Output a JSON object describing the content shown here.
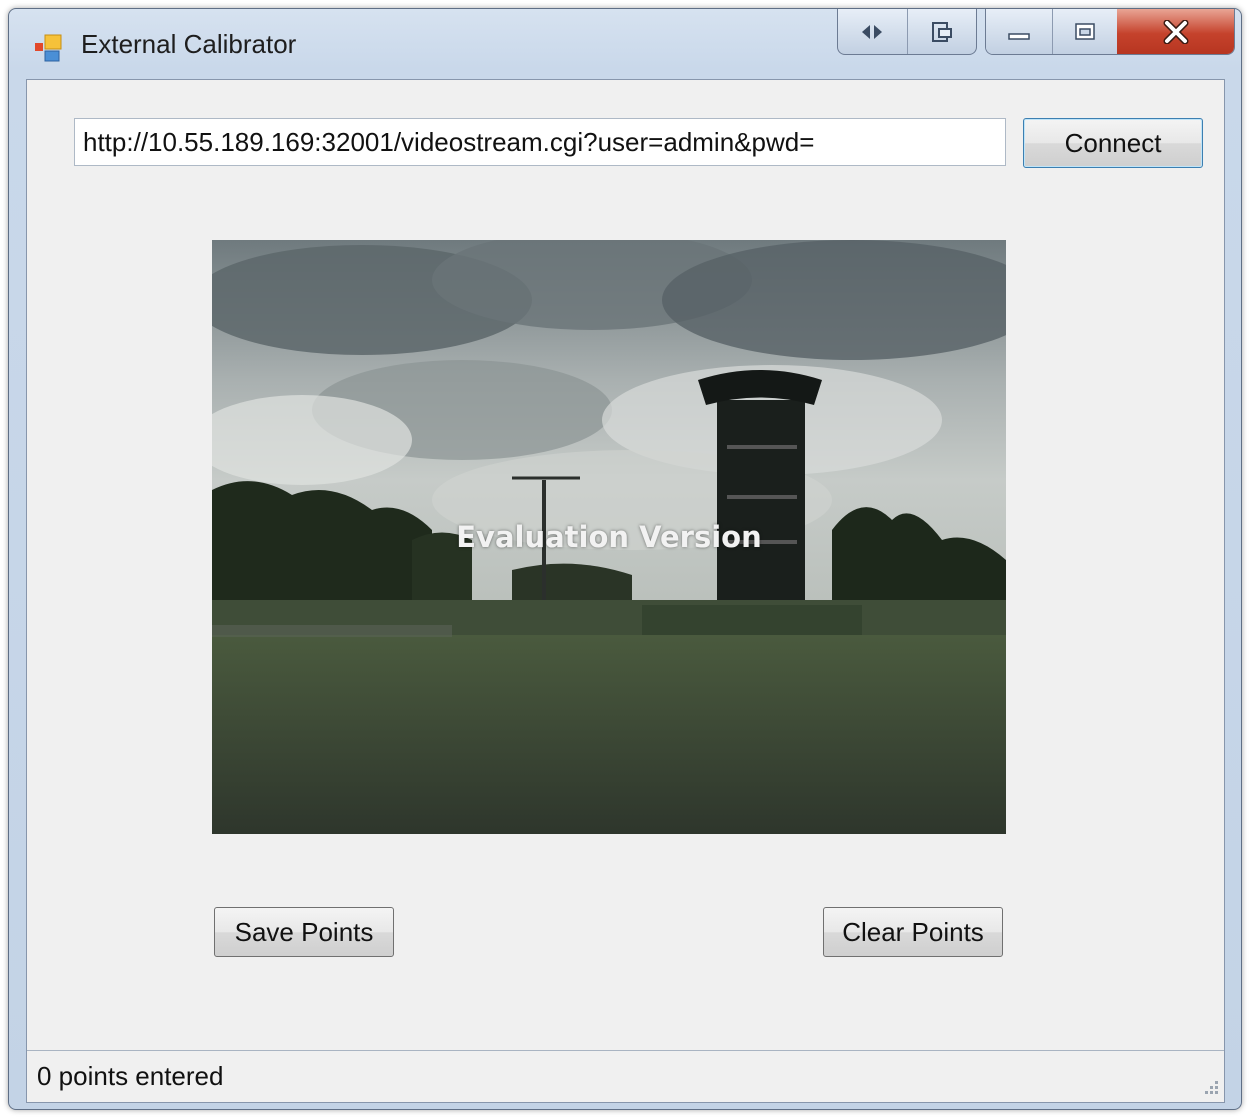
{
  "window": {
    "title": "External Calibrator"
  },
  "stream": {
    "url_value": "http://10.55.189.169:32001/videostream.cgi?user=admin&pwd=",
    "connect_label": "Connect"
  },
  "video": {
    "watermark": "Evaluation Version"
  },
  "actions": {
    "save_label": "Save Points",
    "clear_label": "Clear Points"
  },
  "status": {
    "text": "0 points entered"
  },
  "icons": {
    "app": "app-icon",
    "extra1": "code-brackets-icon",
    "extra2": "export-icon",
    "minimize": "minimize-icon",
    "maximize": "maximize-icon",
    "close": "close-icon",
    "grip": "resize-grip-icon"
  },
  "colors": {
    "close_button": "#c5422c",
    "connect_border": "#3c7fb1"
  }
}
